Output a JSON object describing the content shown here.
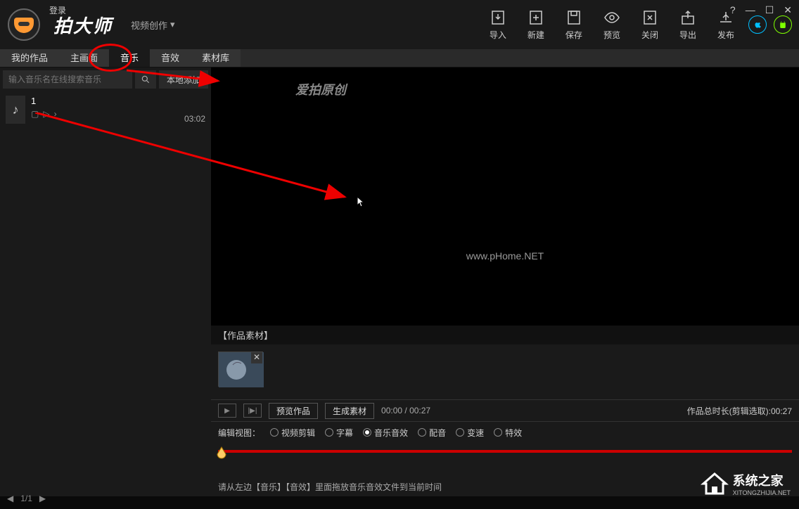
{
  "header": {
    "login": "登录",
    "app_name": "拍大师",
    "mode": "视频创作",
    "tools": {
      "import": "导入",
      "new": "新建",
      "save": "保存",
      "preview": "预览",
      "close": "关闭",
      "export": "导出",
      "publish": "发布"
    }
  },
  "tabs": {
    "works": "我的作品",
    "main_scene": "主画面",
    "music": "音乐",
    "sound": "音效",
    "library": "素材库"
  },
  "search": {
    "placeholder": "输入音乐名在线搜索音乐",
    "local_add": "本地添加"
  },
  "music_item": {
    "title": "1",
    "duration": "03:02"
  },
  "pager": {
    "text": "1/1"
  },
  "preview": {
    "watermark_top": "爱拍原创",
    "watermark_mid": "www.pHome.NET"
  },
  "section": {
    "label": "【作品素材】"
  },
  "controls": {
    "preview_work": "预览作品",
    "gen_material": "生成素材",
    "time_current": "00:00",
    "time_total": "00:27",
    "total_label": "作品总时长(剪辑选取):00:27"
  },
  "edit_view": {
    "label": "编辑视图：",
    "opts": {
      "video_edit": "视频剪辑",
      "subtitle": "字幕",
      "music_sfx": "音乐音效",
      "dub": "配音",
      "speed": "变速",
      "fx": "特效"
    }
  },
  "hint": "请从左边【音乐】【音效】里面拖放音乐音效文件到当前时间",
  "brand": {
    "name": "系统之家",
    "url": "XITONGZHIJIA.NET"
  }
}
